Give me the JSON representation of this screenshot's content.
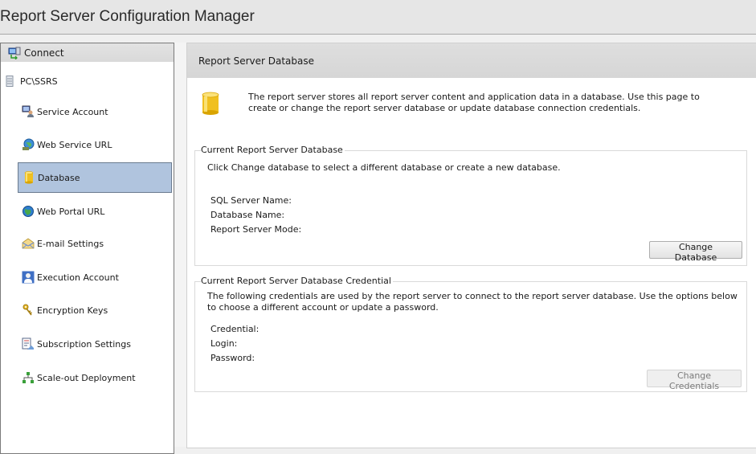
{
  "window": {
    "title": "Report Server Configuration Manager"
  },
  "sidebar": {
    "connect_label": "Connect",
    "server_name": "PC\\SSRS",
    "items": [
      {
        "label": "Service Account",
        "icon": "service-account-icon",
        "active": false
      },
      {
        "label": "Web Service URL",
        "icon": "web-service-url-icon",
        "active": false
      },
      {
        "label": "Database",
        "icon": "database-icon",
        "active": true
      },
      {
        "label": "Web Portal URL",
        "icon": "globe-icon",
        "active": false
      },
      {
        "label": "E-mail Settings",
        "icon": "email-icon",
        "active": false
      },
      {
        "label": "Execution Account",
        "icon": "user-account-icon",
        "active": false
      },
      {
        "label": "Encryption Keys",
        "icon": "keys-icon",
        "active": false
      },
      {
        "label": "Subscription Settings",
        "icon": "subscription-icon",
        "active": false
      },
      {
        "label": "Scale-out Deployment",
        "icon": "scale-out-icon",
        "active": false
      }
    ]
  },
  "main": {
    "header": "Report Server Database",
    "intro": "The report server stores all report server content and application data in a database. Use this page to create or change the report server database or update database connection credentials.",
    "current_db": {
      "legend": "Current Report Server Database",
      "description": "Click Change database to select a different database or create a new database.",
      "fields": [
        {
          "label": "SQL Server Name:",
          "value": ""
        },
        {
          "label": "Database Name:",
          "value": ""
        },
        {
          "label": "Report Server Mode:",
          "value": ""
        }
      ],
      "button": "Change Database"
    },
    "credential": {
      "legend": "Current Report Server Database Credential",
      "description": "The following credentials are used by the report server to connect to the report server database.  Use the options below to choose a different account or update a password.",
      "fields": [
        {
          "label": "Credential:",
          "value": ""
        },
        {
          "label": "Login:",
          "value": ""
        },
        {
          "label": "Password:",
          "value": ""
        }
      ],
      "button": "Change Credentials",
      "button_disabled": true
    }
  },
  "colors": {
    "active_nav_bg": "#b0c4de",
    "active_nav_border": "#6a7b8f",
    "db_icon": "#e8b800"
  }
}
